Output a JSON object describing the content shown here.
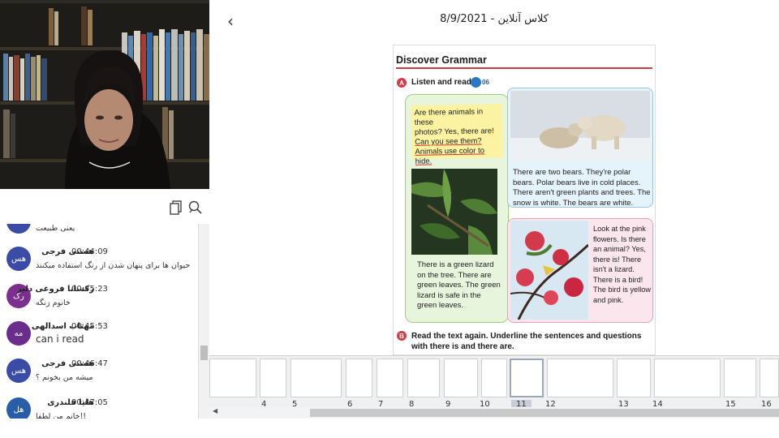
{
  "session": {
    "date": "8/9/2021",
    "title_separator": " - ",
    "class_name": "کلاس آنلاین"
  },
  "toolbar": {
    "back_icon": "chevron-left-icon",
    "copy_icon": "copy-icon",
    "chat_icon": "chat-search-icon"
  },
  "chat": {
    "partial_top": "یعنی طبیعت",
    "messages": [
      {
        "initials": "هس",
        "name": "هستی فرجی",
        "time": "00:44:09",
        "text": "حیوان ها برای پنهان شدن از رنگ استفاده میکنند",
        "color": "#3b4ba6"
      },
      {
        "initials": "رک",
        "name": "رکسانا فروغی دلیر",
        "time": "00:45:23",
        "text": "خانوم زنگه",
        "color": "#7c2f8f"
      },
      {
        "initials": "مه",
        "name": "مهتاب اسدالهی",
        "time": "00:45:53",
        "text": "can i read",
        "color": "#6b2d8c"
      },
      {
        "initials": "هس",
        "name": "هستی فرجی",
        "time": "00:46:47",
        "text": "میشه من بخونم ؟",
        "color": "#3b4ba6"
      },
      {
        "initials": "هل",
        "name": "هلیا قلندری",
        "time": "00:47:05",
        "text": "خانم من لطفا!!",
        "color": "#2a5da8"
      }
    ]
  },
  "slide": {
    "heading": "Discover Grammar",
    "section_a_letter": "A",
    "section_a": "Listen and read.",
    "audio_track": "06",
    "question_box": [
      "Are there animals in these",
      "photos? Yes, there are!",
      "Can you see them?",
      "Animals use color to hide."
    ],
    "bears_caption": "There are two bears. They're polar bears. Polar bears live in cold places. There aren't green plants and trees. The snow is white. The bears are white.",
    "lizard_caption": "There is a green lizard on the tree. There are green leaves. The green lizard is safe in the green leaves.",
    "flower_caption": "Look at the pink flowers. Is there an animal? Yes, there is! There isn't a lizard. There is a bird! The bird is yellow and pink.",
    "section_b_letter": "B",
    "section_b": "Read the text again. Underline the sentences and questions with there is and there are."
  },
  "thumbnails": {
    "numbers": [
      "4",
      "5",
      "6",
      "7",
      "8",
      "9",
      "10",
      "11",
      "12",
      "13",
      "14",
      "15",
      "16"
    ],
    "selected": "11"
  }
}
